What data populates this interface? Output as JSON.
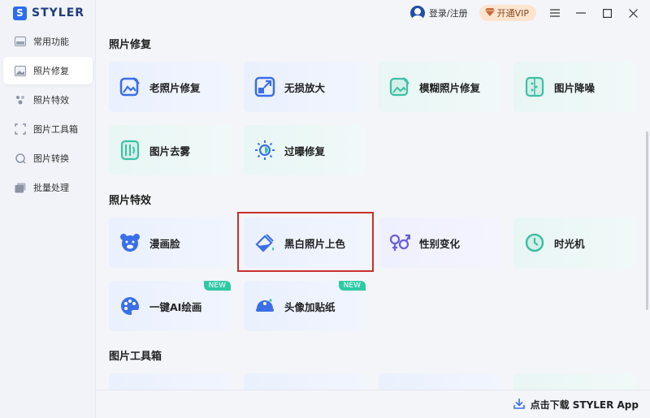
{
  "app": {
    "logo_mark": "S",
    "name": "STYLER"
  },
  "sidebar": {
    "items": [
      {
        "label": "常用功能",
        "icon": "common-functions-icon",
        "active": false
      },
      {
        "label": "照片修复",
        "icon": "photo-repair-icon",
        "active": true
      },
      {
        "label": "照片特效",
        "icon": "photo-effects-icon",
        "active": false
      },
      {
        "label": "图片工具箱",
        "icon": "toolbox-icon",
        "active": false
      },
      {
        "label": "图片转换",
        "icon": "convert-icon",
        "active": false
      },
      {
        "label": "批量处理",
        "icon": "batch-icon",
        "active": false
      }
    ]
  },
  "topbar": {
    "login_label": "登录/注册",
    "vip_label": "开通VIP",
    "vip_icon": "diamond-icon"
  },
  "sections": {
    "repair": {
      "title": "照片修复",
      "cards": [
        {
          "label": "老照片修复",
          "icon": "old-photo-icon"
        },
        {
          "label": "无损放大",
          "icon": "enlarge-icon"
        },
        {
          "label": "模糊照片修复",
          "icon": "blur-fix-icon"
        },
        {
          "label": "图片降噪",
          "icon": "denoise-icon"
        },
        {
          "label": "图片去雾",
          "icon": "dehaze-icon"
        },
        {
          "label": "过曝修复",
          "icon": "overexposure-icon"
        }
      ]
    },
    "effects": {
      "title": "照片特效",
      "cards": [
        {
          "label": "漫画脸",
          "icon": "cartoon-face-icon"
        },
        {
          "label": "黑白照片上色",
          "icon": "colorize-icon"
        },
        {
          "label": "性别变化",
          "icon": "gender-swap-icon"
        },
        {
          "label": "时光机",
          "icon": "time-machine-icon"
        },
        {
          "label": "一键AI绘画",
          "icon": "ai-painting-icon",
          "badge": "NEW"
        },
        {
          "label": "头像加贴纸",
          "icon": "sticker-icon",
          "badge": "NEW"
        }
      ]
    },
    "toolbox": {
      "title": "图片工具箱"
    }
  },
  "bottombar": {
    "download_label": "点击下载 STYLER App"
  },
  "colors": {
    "brand": "#2d6bf0",
    "accent_teal": "#2fc9a4",
    "highlight_red": "#c9302c",
    "vip_bg": "#fde4cf"
  }
}
